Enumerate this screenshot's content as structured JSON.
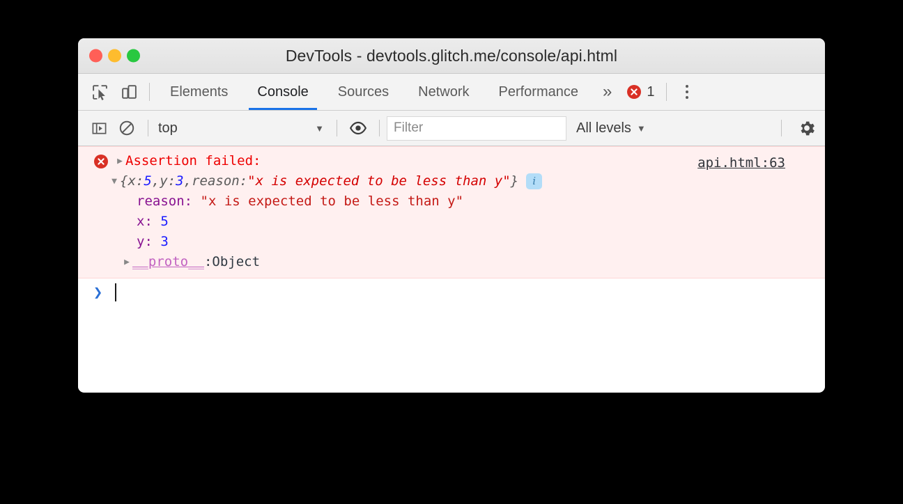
{
  "window": {
    "title": "DevTools - devtools.glitch.me/console/api.html",
    "traffic_lights": [
      {
        "name": "close",
        "color": "#ff5f57"
      },
      {
        "name": "minimize",
        "color": "#febc2e"
      },
      {
        "name": "zoom",
        "color": "#28c840"
      }
    ]
  },
  "tabbar": {
    "inspect_icon": "inspect-element-icon",
    "device_icon": "device-toolbar-icon",
    "tabs": [
      {
        "label": "Elements",
        "active": false
      },
      {
        "label": "Console",
        "active": true
      },
      {
        "label": "Sources",
        "active": false
      },
      {
        "label": "Network",
        "active": false
      },
      {
        "label": "Performance",
        "active": false
      }
    ],
    "more_label": "»",
    "error_count": "1",
    "error_icon": "error-circle-icon",
    "menu_icon": "more-vertical-icon",
    "active_underline_color": "#1a73e8"
  },
  "console_toolbar": {
    "sidebar_icon": "show-console-sidebar-icon",
    "clear_icon": "clear-console-icon",
    "context": "top",
    "context_caret": "▼",
    "eye_icon": "live-expression-eye-icon",
    "filter_placeholder": "Filter",
    "filter_value": "",
    "levels": "All levels",
    "levels_caret": "▼",
    "settings_icon": "settings-gear-icon"
  },
  "console": {
    "message": {
      "level": "error",
      "level_icon": "error-circle-icon",
      "collapse_triangle": "▶",
      "text": "Assertion failed:",
      "source": "api.html:63",
      "background_color": "#fff0f0",
      "text_color": "#ee0000"
    },
    "object": {
      "expand_triangle": "▼",
      "preview_open": "{",
      "preview_close": "}",
      "preview_parts": [
        {
          "key": "x",
          "sep": ": ",
          "value": "5",
          "type": "number",
          "trail": ", "
        },
        {
          "key": "y",
          "sep": ": ",
          "value": "3",
          "type": "number",
          "trail": ", "
        },
        {
          "key": "reason",
          "sep": ": ",
          "value": "\"x is expected to be less than y\"",
          "type": "string",
          "trail": ""
        }
      ],
      "info_badge": "i",
      "info_badge_color": "#b3ddf8",
      "properties": [
        {
          "key": "reason",
          "value": "\"x is expected to be less than y\"",
          "type": "string"
        },
        {
          "key": "x",
          "value": "5",
          "type": "number"
        },
        {
          "key": "y",
          "value": "3",
          "type": "number"
        }
      ],
      "proto": {
        "triangle": "▶",
        "key": "__proto__",
        "sep": ": ",
        "value": "Object"
      }
    },
    "prompt": {
      "chevron": "❯",
      "input_value": ""
    }
  }
}
